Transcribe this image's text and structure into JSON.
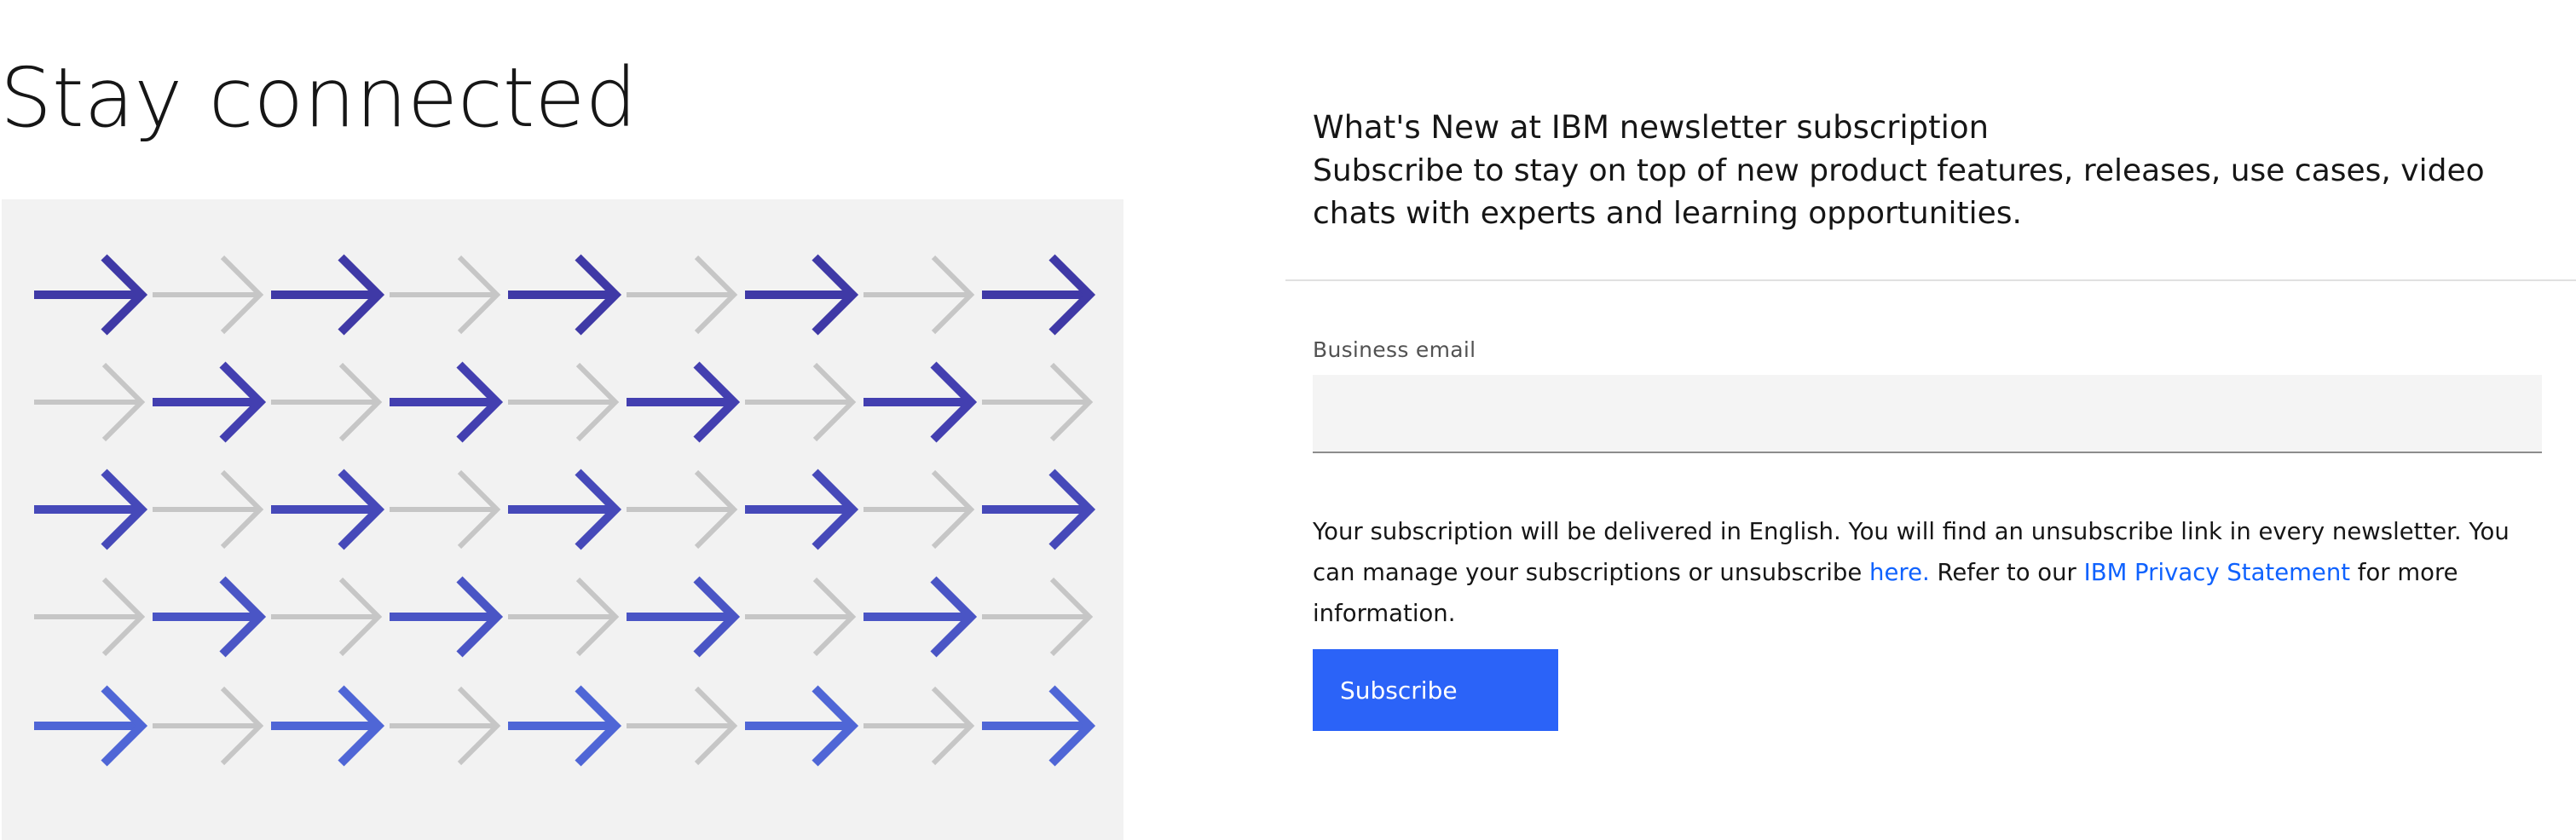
{
  "page": {
    "title": "Stay connected"
  },
  "illustration": {
    "description_icon": "arrow-pattern-icon",
    "colors": {
      "background": "#f2f2f2",
      "gray_arrow": "#c6c6c6",
      "blue_row_colors": [
        "#3f39a6",
        "#433fb0",
        "#4649b9",
        "#4a55c5",
        "#4f66d6"
      ]
    }
  },
  "newsletter": {
    "heading": "What's New at IBM newsletter subscription",
    "description": "Subscribe to stay on top of new product features, releases, use cases, video chats with experts and learning opportunities.",
    "email_label": "Business email",
    "email_value": "",
    "email_placeholder": "",
    "legal_part1": "Your subscription will be delivered in English. You will find an unsubscribe link in every newsletter. You can manage your subscriptions or unsubscribe ",
    "legal_link_here": "here.",
    "legal_part2": " Refer to our ",
    "legal_link_privacy": "IBM Privacy Statement",
    "legal_part3": " for more information.",
    "subscribe_label": "Subscribe",
    "colors": {
      "accent": "#2b63f8",
      "link": "#0f62fe",
      "field_background": "#f4f4f4"
    }
  }
}
